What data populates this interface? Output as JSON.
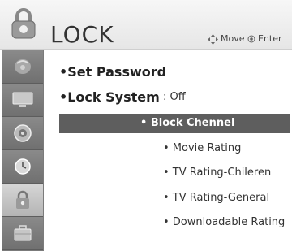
{
  "header": {
    "title": "LOCK",
    "hint_move": "Move",
    "hint_enter": "Enter"
  },
  "sidebar": {
    "items": [
      {
        "icon": "satellite-icon"
      },
      {
        "icon": "tv-screen-icon"
      },
      {
        "icon": "speaker-icon"
      },
      {
        "icon": "clock-icon"
      },
      {
        "icon": "lock-icon",
        "active": true
      },
      {
        "icon": "briefcase-icon"
      }
    ]
  },
  "menu": {
    "items": [
      {
        "label": "•Set Password"
      },
      {
        "label": "•Lock System"
      }
    ],
    "lock_system_value": ": Off"
  },
  "submenu": {
    "items": [
      {
        "label": "• Block Chennel",
        "selected": true
      },
      {
        "label": "• Movie Rating"
      },
      {
        "label": "• TV Rating-Chileren"
      },
      {
        "label": "• TV Rating-General"
      },
      {
        "label": "• Downloadable Rating"
      }
    ]
  },
  "colors": {
    "highlight": "#5e5e5e",
    "sidebar": "#7b7b7b"
  }
}
